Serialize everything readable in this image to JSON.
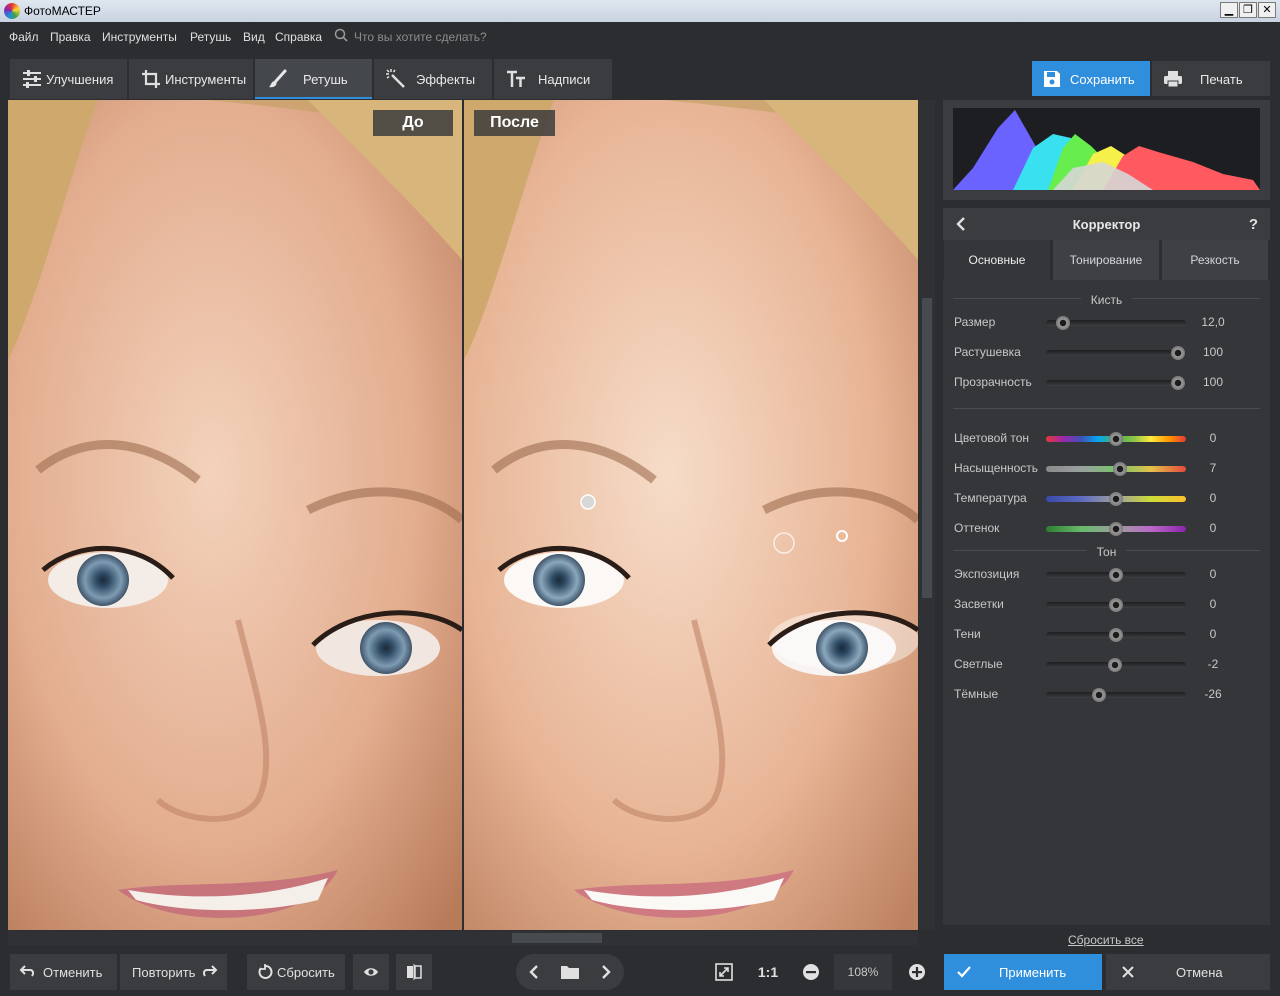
{
  "window": {
    "title": "ФотоМАСТЕР",
    "min": "▁",
    "max": "❐",
    "close": "✕"
  },
  "menu": [
    "Файл",
    "Правка",
    "Инструменты",
    "Ретушь",
    "Вид",
    "Справка"
  ],
  "search": {
    "placeholder": "Что вы хотите сделать?"
  },
  "tabs": [
    {
      "label": "Улучшения",
      "icon": "sliders-icon"
    },
    {
      "label": "Инструменты",
      "icon": "crop-icon"
    },
    {
      "label": "Ретушь",
      "icon": "brush-icon",
      "active": true
    },
    {
      "label": "Эффекты",
      "icon": "magic-wand-icon"
    },
    {
      "label": "Надписи",
      "icon": "text-icon"
    }
  ],
  "actions": {
    "save": "Сохранить",
    "print": "Печать"
  },
  "preview": {
    "before": "До",
    "after": "После"
  },
  "corrector": {
    "title": "Корректор",
    "help": "?",
    "subtabs": [
      "Основные",
      "Тонирование",
      "Резкость"
    ],
    "brush_section": "Кисть",
    "brush": [
      {
        "label": "Размер",
        "value": "12,0",
        "pos": 0.12
      },
      {
        "label": "Растушевка",
        "value": "100",
        "pos": 0.94
      },
      {
        "label": "Прозрачность",
        "value": "100",
        "pos": 0.94
      }
    ],
    "color": [
      {
        "label": "Цветовой тон",
        "value": "0",
        "pos": 0.5,
        "track": "hue"
      },
      {
        "label": "Насыщенность",
        "value": "7",
        "pos": 0.53,
        "track": "sat"
      },
      {
        "label": "Температура",
        "value": "0",
        "pos": 0.5,
        "track": "temp"
      },
      {
        "label": "Оттенок",
        "value": "0",
        "pos": 0.5,
        "track": "tint"
      }
    ],
    "tone_section": "Тон",
    "tone": [
      {
        "label": "Экспозиция",
        "value": "0",
        "pos": 0.5
      },
      {
        "label": "Засветки",
        "value": "0",
        "pos": 0.5
      },
      {
        "label": "Тени",
        "value": "0",
        "pos": 0.5
      },
      {
        "label": "Светлые",
        "value": "-2",
        "pos": 0.49
      },
      {
        "label": "Тёмные",
        "value": "-26",
        "pos": 0.38
      }
    ],
    "reset_all": "Сбросить все"
  },
  "bottom": {
    "undo": "Отменить",
    "redo": "Повторить",
    "reset": "Сбросить",
    "zoom_1to1": "1:1",
    "zoom": "108%",
    "apply": "Применить",
    "cancel": "Отмена"
  },
  "colors": {
    "accent": "#2f8fdc",
    "panel": "#34363a",
    "background": "#2b2d30"
  }
}
